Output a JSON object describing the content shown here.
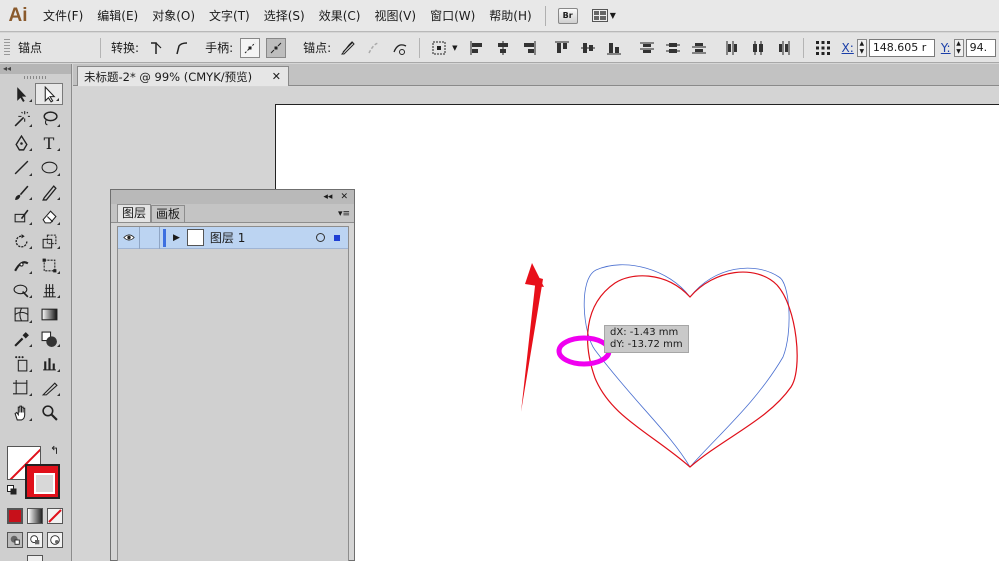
{
  "app": {
    "logo": "Ai"
  },
  "menu": [
    {
      "label": "文件(F)"
    },
    {
      "label": "编辑(E)"
    },
    {
      "label": "对象(O)"
    },
    {
      "label": "文字(T)"
    },
    {
      "label": "选择(S)"
    },
    {
      "label": "效果(C)"
    },
    {
      "label": "视图(V)"
    },
    {
      "label": "窗口(W)"
    },
    {
      "label": "帮助(H)"
    }
  ],
  "bridge_button": "Br",
  "control_bar": {
    "anchor_label": "锚点",
    "convert_label": "转换:",
    "handles_label": "手柄:",
    "anchors_label": "锚点:",
    "x_label": "X:",
    "x_value": "148.605 r",
    "y_label": "Y:",
    "y_value": "94."
  },
  "document_tab": {
    "title": "未标题-2* @ 99% (CMYK/预览)",
    "close": "✕"
  },
  "tools": {
    "type_glyph": "T",
    "swap_glyph": "↰"
  },
  "layers_panel": {
    "collapse": "◂◂",
    "close": "✕",
    "tabs": [
      "图层",
      "画板"
    ],
    "menu": "▾≡",
    "layers": [
      {
        "name": "图层 1"
      }
    ]
  },
  "measure_tooltip": {
    "dx": "dX: -1.43 mm",
    "dy": "dY: -13.72 mm"
  },
  "colors": {
    "heart_original": "#4a6fd0",
    "heart_moved": "#e0101a",
    "highlight_ellipse": "#f000f0",
    "arrow": "#e8101a",
    "accent_fill_stroke": "#e0101a"
  }
}
